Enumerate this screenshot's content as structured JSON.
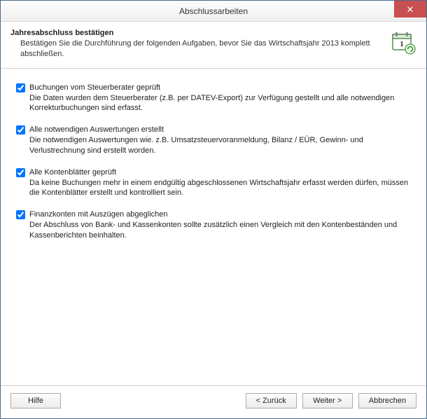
{
  "window": {
    "title": "Abschlussarbeiten"
  },
  "header": {
    "title": "Jahresabschluss bestätigen",
    "subtitle": "Bestätigen Sie die Durchführung der folgenden Aufgaben, bevor Sie das Wirtschaftsjahr 2013 komplett abschließen."
  },
  "tasks": [
    {
      "checked": true,
      "title": "Buchungen vom Steuerberater geprüft",
      "desc": "Die Daten wurden dem Steuerberater (z.B. per DATEV-Export) zur Verfügung gestellt und alle notwendigen Korrekturbuchungen sind erfasst."
    },
    {
      "checked": true,
      "title": "Alle notwendigen Auswertungen erstellt",
      "desc": "Die notwendigen Auswertungen wie. z.B. Umsatzsteuervoranmeldung, Bilanz / EÜR, Gewinn- und Verlustrechnung sind erstellt worden."
    },
    {
      "checked": true,
      "title": "Alle Kontenblätter geprüft",
      "desc": "Da keine Buchungen mehr in einem endgültig abgeschlossenen Wirtschaftsjahr erfasst werden dürfen, müssen die Kontenblätter erstellt und kontrolliert sein."
    },
    {
      "checked": true,
      "title": "Finanzkonten mit Auszügen abgeglichen",
      "desc": "Der Abschluss von Bank- und Kassenkonten sollte zusätzlich einen Vergleich mit den Kontenbeständen und Kassenberichten beinhalten."
    }
  ],
  "buttons": {
    "help": "Hilfe",
    "back": "< Zurück",
    "next": "Weiter >",
    "cancel": "Abbrechen"
  },
  "icons": {
    "close": "✕"
  }
}
